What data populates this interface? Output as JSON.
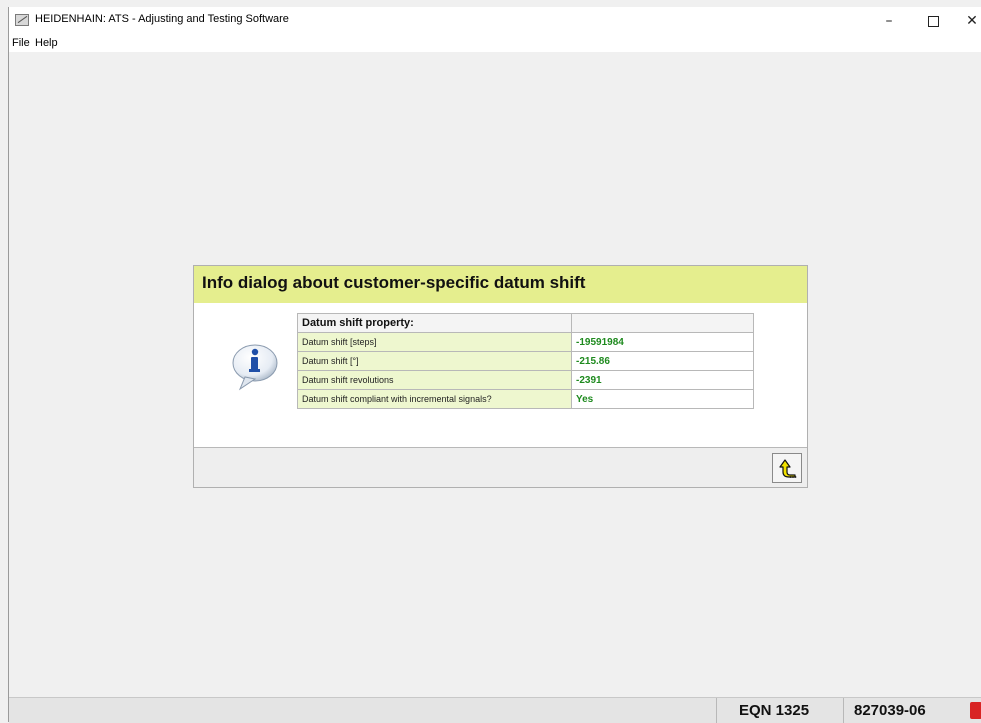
{
  "window": {
    "title": "HEIDENHAIN: ATS - Adjusting and Testing Software",
    "controls": {
      "minimize": "–",
      "close": "✕"
    }
  },
  "menu": {
    "file": "File",
    "help": "Help"
  },
  "dialog": {
    "title": "Info dialog about customer-specific datum shift",
    "table": {
      "header": {
        "property": "Datum shift property:",
        "value": ""
      },
      "rows": [
        {
          "label": "Datum shift [steps]",
          "value": "-19591984"
        },
        {
          "label": "Datum shift [°]",
          "value": "-215.86"
        },
        {
          "label": "Datum shift revolutions",
          "value": "-2391"
        },
        {
          "label": "Datum shift compliant with incremental signals?",
          "value": "Yes"
        }
      ]
    },
    "icons": {
      "info": "info-speech-bubble-icon",
      "back": "return-arrow-icon"
    }
  },
  "status": {
    "device": "EQN 1325",
    "id": "827039-06",
    "indicator_color": "#d82424"
  },
  "colors": {
    "header_bg": "#e5ee8e",
    "label_bg": "#eef7cf",
    "value_text": "#1e8a1e"
  }
}
